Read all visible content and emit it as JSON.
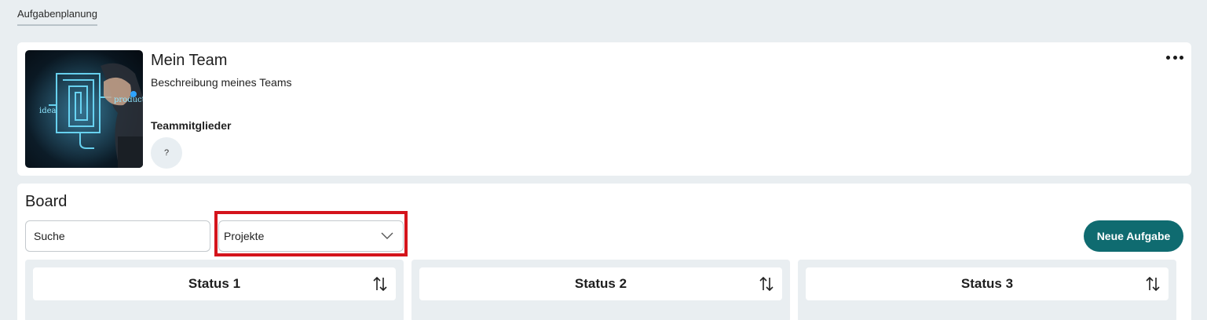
{
  "top_tab": {
    "label": "Aufgabenplanung"
  },
  "team": {
    "title": "Mein Team",
    "description": "Beschreibung meines Teams",
    "members_label": "Teammitglieder",
    "members": [
      {
        "initials": "?"
      }
    ],
    "image_words": {
      "left": "idea",
      "right": "product"
    }
  },
  "board": {
    "title": "Board",
    "search": {
      "placeholder": "Suche",
      "value": ""
    },
    "project_select": {
      "value": "Projekte"
    },
    "new_task_label": "Neue Aufgabe",
    "columns": [
      {
        "title": "Status 1"
      },
      {
        "title": "Status 2"
      },
      {
        "title": "Status 3"
      }
    ]
  },
  "colors": {
    "background": "#e9eef1",
    "primary_button": "#0f6b70",
    "highlight": "#d4141c"
  },
  "icons": {
    "more": "more-horizontal-icon",
    "chevron": "chevron-down-icon",
    "sort": "sort-arrows-icon"
  }
}
